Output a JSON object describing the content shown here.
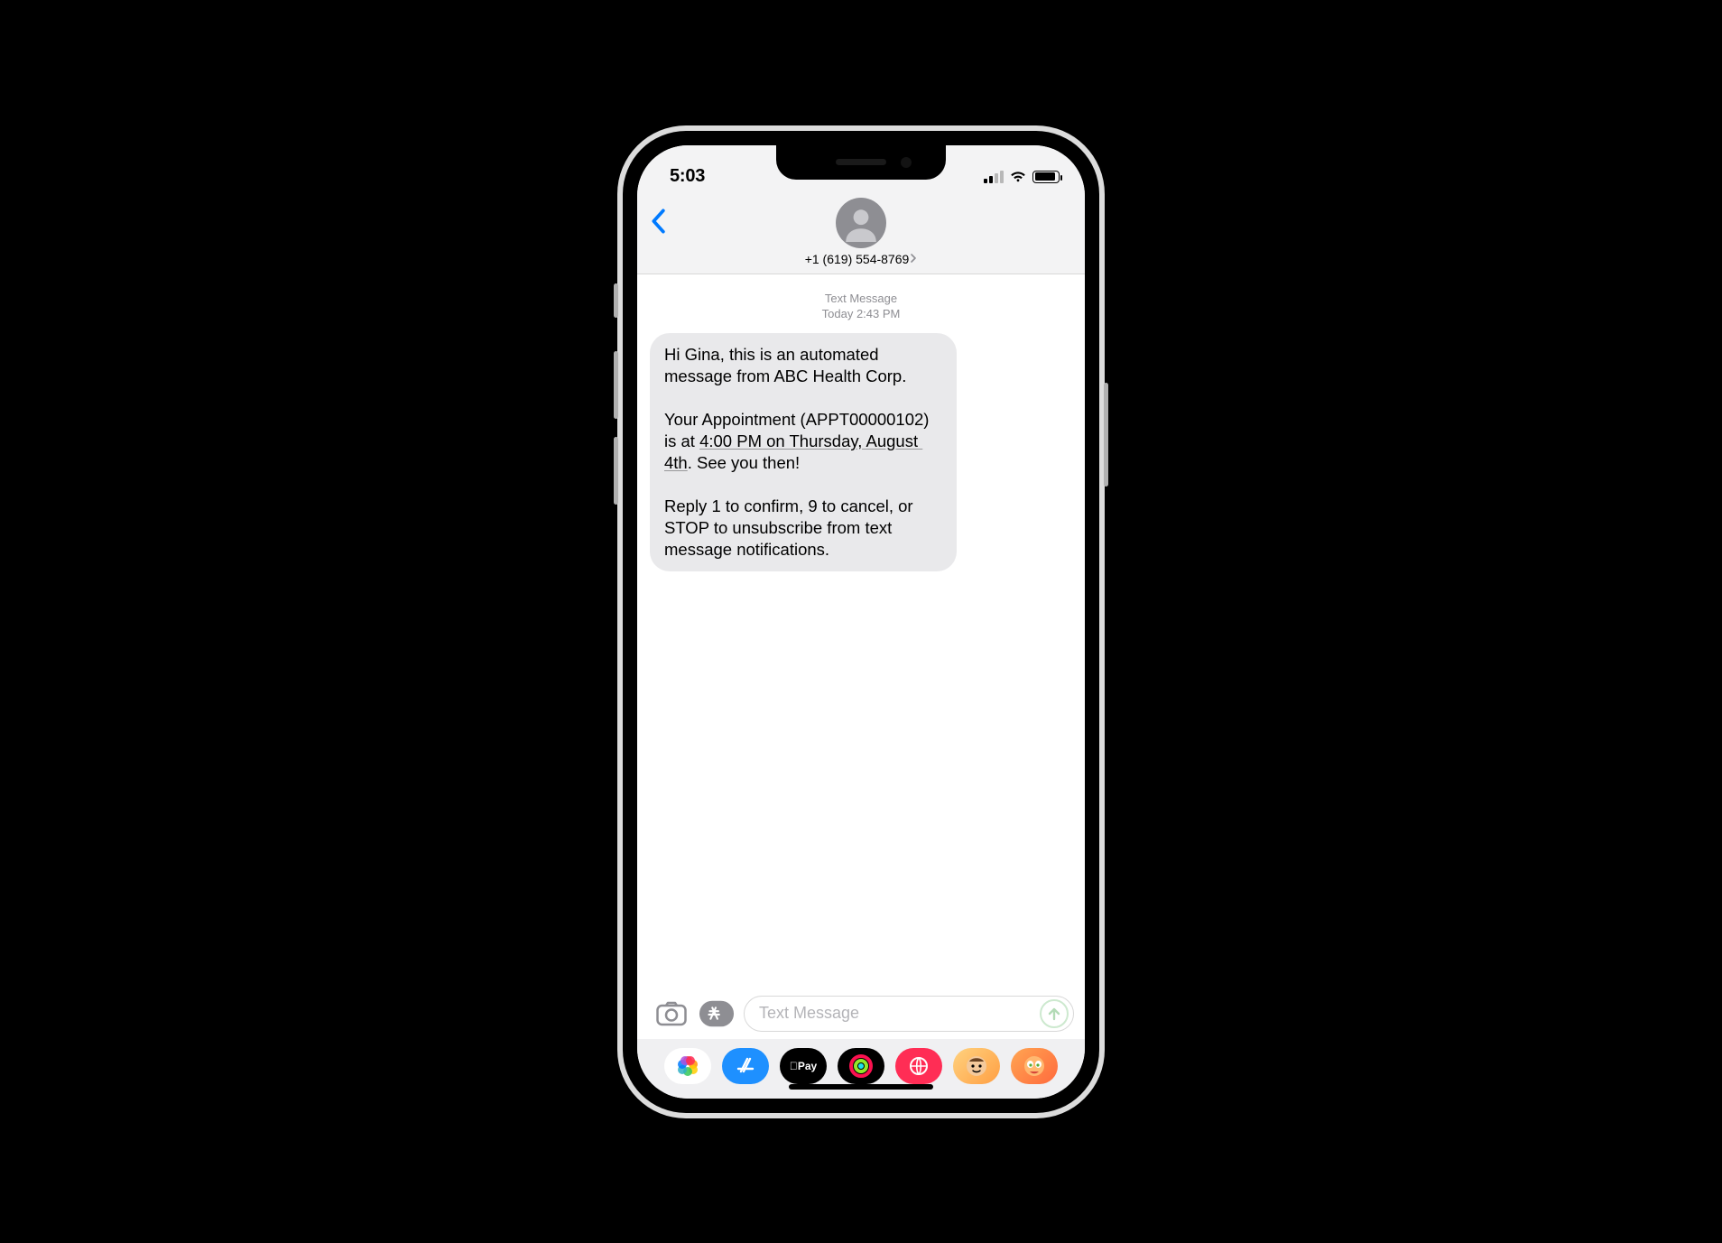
{
  "status": {
    "time": "5:03"
  },
  "header": {
    "contact_number": "+1 (619) 554-8769"
  },
  "thread": {
    "meta_line1": "Text Message",
    "meta_day": "Today",
    "meta_time": "2:43 PM"
  },
  "message": {
    "seg1": "Hi Gina, this is an automated message from ABC Health Corp.",
    "seg2a": "Your Appointment (APPT00000102) is at ",
    "seg2_dd": "4:00 PM on Thursday, August 4th",
    "seg2b": ". See you then!",
    "seg3": "Reply 1 to confirm, 9 to cancel, or STOP to unsubscribe from text message notifications."
  },
  "compose": {
    "placeholder": "Text Message"
  },
  "apps": {
    "apple_pay_label": "Pay"
  }
}
